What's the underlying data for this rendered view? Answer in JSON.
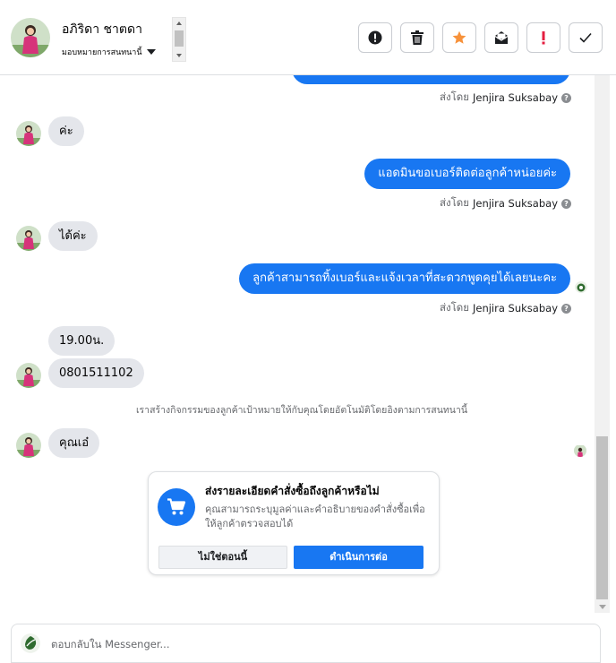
{
  "header": {
    "contact_name": "อภิริดา ชาตดา",
    "assign_label": "มอบหมายการสนทนานี้",
    "actions": [
      {
        "icon": "exclamation-circle-icon"
      },
      {
        "icon": "trash-icon"
      },
      {
        "icon": "star-icon",
        "color": "#f7923b"
      },
      {
        "icon": "envelope-icon"
      },
      {
        "icon": "exclamation-mark-icon",
        "color": "#e41e3f"
      },
      {
        "icon": "checkmark-icon"
      }
    ]
  },
  "messages": {
    "sent_by_prefix": "ส่งโดย",
    "agent_name": "Jenjira Suksabay",
    "in_1": "ค่ะ",
    "out_1": "แอดมินขอเบอร์ติดต่อลูกค้าหน่อยค่ะ",
    "in_2": "ได้ค่ะ",
    "out_2": "ลูกค้าสามารถทิ้งเบอร์และแจ้งเวลาที่สะดวกพูดคุยได้เลยนะคะ",
    "in_3": "19.00น.",
    "in_4": "0801511102",
    "system_note": "เราสร้างกิจกรรมของลูกค้าเป้าหมายให้กับคุณโดยอัตโนมัติโดยอิงตามการสนทนานี้",
    "in_5": "คุณเอ๋"
  },
  "order_card": {
    "title": "ส่งรายละเอียดคำสั่งซื้อถึงลูกค้าหรือไม่",
    "description": "คุณสามารถระบุมูลค่าและคำอธิบายของคำสั่งซื้อเพื่อให้ลูกค้าตรวจสอบได้",
    "secondary_button": "ไม่ใช่ตอนนี้",
    "primary_button": "ดำเนินการต่อ",
    "icon": "shopping-cart-icon"
  },
  "reply": {
    "placeholder": "ตอบกลับใน Messenger..."
  },
  "colors": {
    "accent": "#1877f2",
    "incoming_bubble": "#e4e6eb"
  }
}
